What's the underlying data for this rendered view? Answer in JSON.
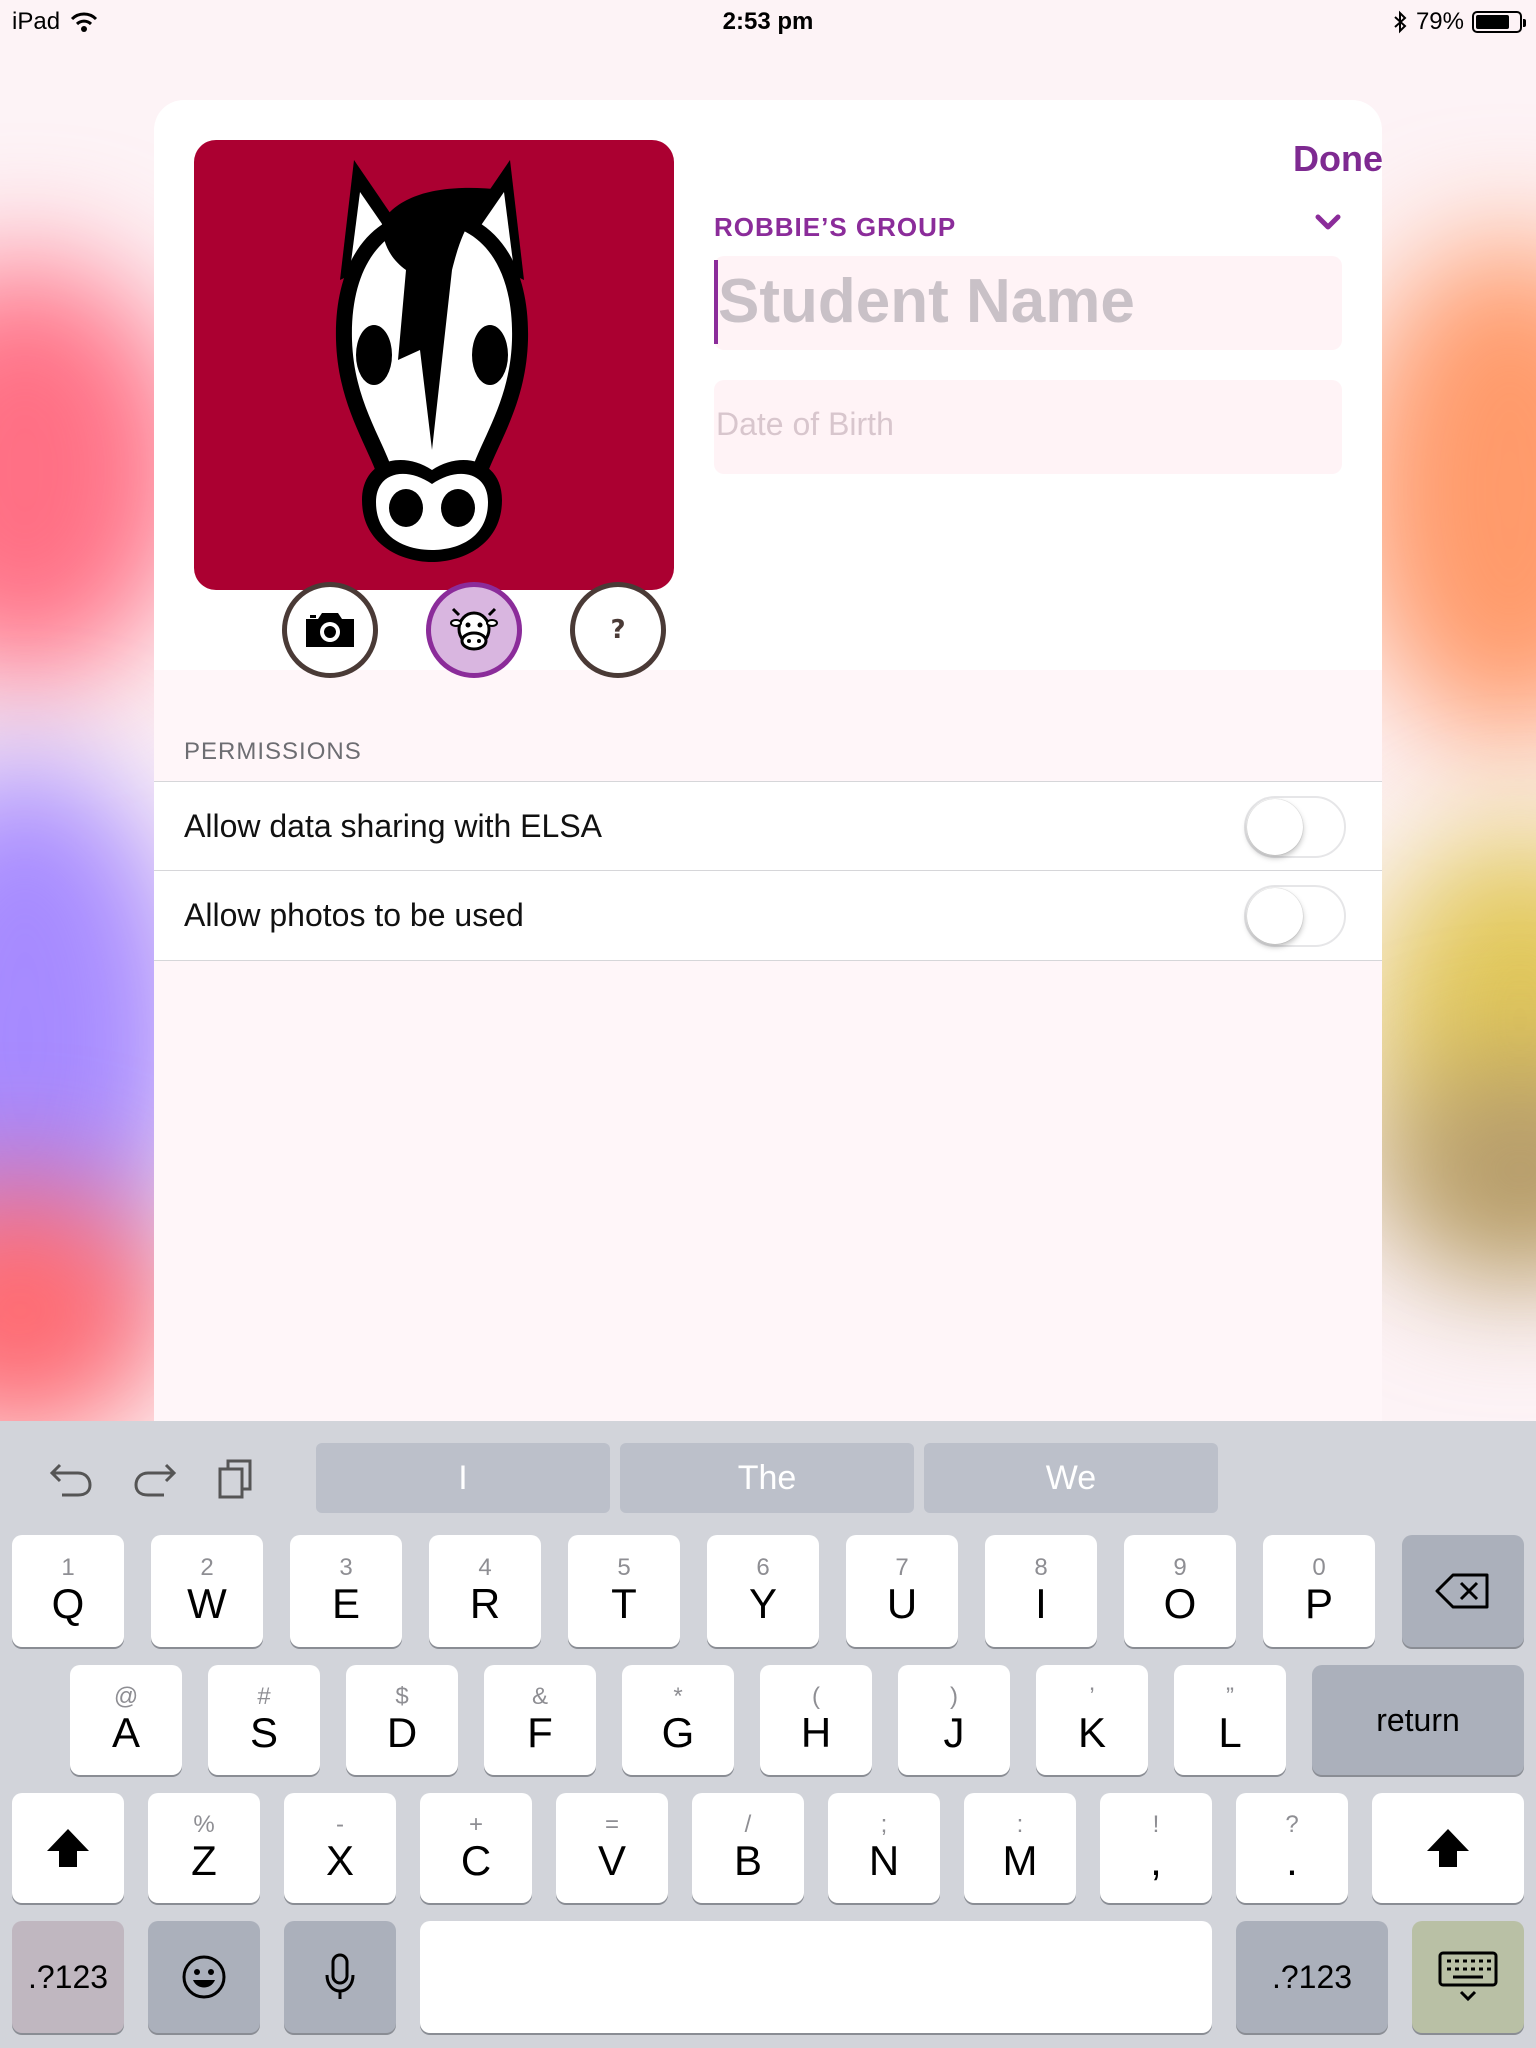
{
  "status_bar": {
    "device": "iPad",
    "time": "2:53 pm",
    "battery": "79%",
    "battery_level": 0.79
  },
  "sheet": {
    "done_label": "Done",
    "group_label": "ROBBIE’S GROUP",
    "name_placeholder": "Student Name",
    "dob_placeholder": "Date of Birth",
    "avatar_color": "#ab0031",
    "accent_color": "#8b2c9a",
    "avatar_buttons": [
      {
        "icon": "camera-icon"
      },
      {
        "icon": "cow-icon",
        "selected": true
      },
      {
        "label": "?"
      }
    ]
  },
  "permissions": {
    "header": "PERMISSIONS",
    "rows": [
      {
        "label": "Allow data sharing with ELSA",
        "on": false
      },
      {
        "label": "Allow photos to be used",
        "on": false
      }
    ]
  },
  "keyboard": {
    "suggestions": [
      "I",
      "The",
      "We"
    ],
    "row1": [
      {
        "main": "Q",
        "sub": "1"
      },
      {
        "main": "W",
        "sub": "2"
      },
      {
        "main": "E",
        "sub": "3"
      },
      {
        "main": "R",
        "sub": "4"
      },
      {
        "main": "T",
        "sub": "5"
      },
      {
        "main": "Y",
        "sub": "6"
      },
      {
        "main": "U",
        "sub": "7"
      },
      {
        "main": "I",
        "sub": "8"
      },
      {
        "main": "O",
        "sub": "9"
      },
      {
        "main": "P",
        "sub": "0"
      }
    ],
    "row2": [
      {
        "main": "A",
        "sub": "@"
      },
      {
        "main": "S",
        "sub": "#"
      },
      {
        "main": "D",
        "sub": "$"
      },
      {
        "main": "F",
        "sub": "&"
      },
      {
        "main": "G",
        "sub": "*"
      },
      {
        "main": "H",
        "sub": "("
      },
      {
        "main": "J",
        "sub": ")"
      },
      {
        "main": "K",
        "sub": "’"
      },
      {
        "main": "L",
        "sub": "”"
      }
    ],
    "row3": [
      {
        "main": "Z",
        "sub": "%"
      },
      {
        "main": "X",
        "sub": "-"
      },
      {
        "main": "C",
        "sub": "+"
      },
      {
        "main": "V",
        "sub": "="
      },
      {
        "main": "B",
        "sub": "/"
      },
      {
        "main": "N",
        "sub": ";"
      },
      {
        "main": "M",
        "sub": ":"
      },
      {
        "main": ",",
        "sub": "!"
      },
      {
        "main": ".",
        "sub": "?"
      }
    ],
    "return_label": "return",
    "numbers_label": ".?123"
  }
}
